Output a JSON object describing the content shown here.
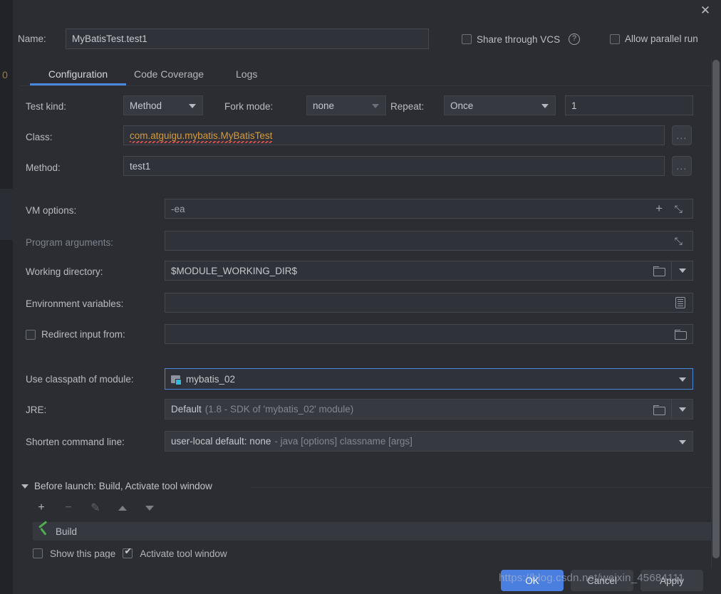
{
  "window": {
    "close_label": "✕"
  },
  "header": {
    "name_label": "Name:",
    "name_value": "MyBatisTest.test1",
    "share_vcs_label": "Share through VCS",
    "share_vcs_checked": false,
    "help_glyph": "?",
    "allow_parallel_label": "Allow parallel run",
    "allow_parallel_checked": false
  },
  "tabs": [
    {
      "label": "Configuration",
      "active": true
    },
    {
      "label": "Code Coverage",
      "active": false
    },
    {
      "label": "Logs",
      "active": false
    }
  ],
  "form": {
    "test_kind": {
      "label": "Test kind:",
      "value": "Method"
    },
    "fork_mode": {
      "label": "Fork mode:",
      "value": "none"
    },
    "repeat": {
      "label": "Repeat:",
      "value": "Once",
      "count": "1"
    },
    "class": {
      "label": "Class:",
      "value": "com.atguigu.mybatis.MyBatisTest",
      "browse": "..."
    },
    "method": {
      "label": "Method:",
      "value": "test1",
      "browse": "..."
    },
    "vm_options": {
      "label": "VM options:",
      "value": "-ea"
    },
    "program_arguments": {
      "label": "Program arguments:",
      "value": ""
    },
    "working_directory": {
      "label": "Working directory:",
      "value": "$MODULE_WORKING_DIR$"
    },
    "environment_variables": {
      "label": "Environment variables:",
      "value": ""
    },
    "redirect_input": {
      "label": "Redirect input from:",
      "checked": false,
      "value": ""
    },
    "classpath_module": {
      "label": "Use classpath of module:",
      "value": "mybatis_02"
    },
    "jre": {
      "label": "JRE:",
      "value": "Default",
      "detail": "(1.8 - SDK of 'mybatis_02' module)"
    },
    "shorten_command_line": {
      "label": "Shorten command line:",
      "value": "user-local default: none",
      "detail": "- java [options] classname [args]"
    }
  },
  "before_launch": {
    "title": "Before launch: Build, Activate tool window",
    "toolbar": {
      "add": "+",
      "remove": "−",
      "edit": "✎",
      "move_up": "▲",
      "move_down": "▼"
    },
    "items": [
      {
        "label": "Build",
        "icon": "hammer-icon"
      }
    ],
    "show_this_page": {
      "label": "Show this page",
      "checked": false
    },
    "activate_tool_window": {
      "label": "Activate tool window",
      "checked": true
    }
  },
  "footer": {
    "ok": "OK",
    "cancel": "Cancel",
    "apply": "Apply"
  },
  "watermark": "https://blog.csdn.net/weixin_45684111"
}
